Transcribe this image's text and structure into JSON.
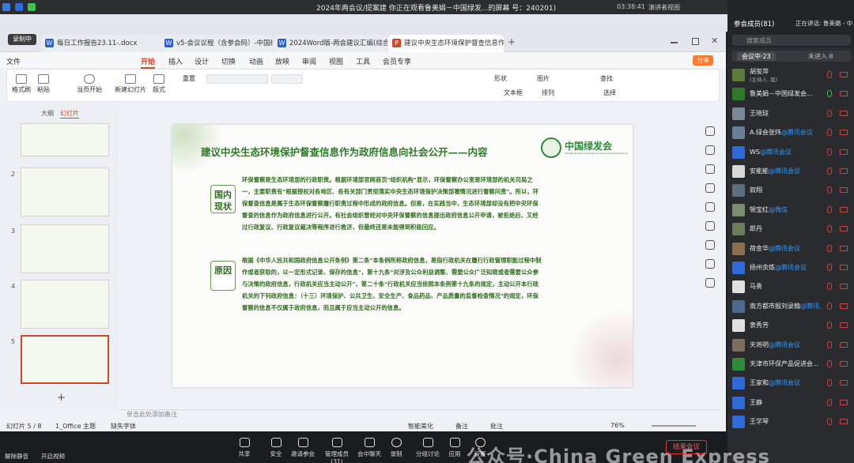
{
  "meeting": {
    "title": "2024年两会议/提案建",
    "screen_share_text": "你正在观看鲁美娟－中国绿发...的屏幕",
    "meeting_id": "号：240201)",
    "timer": "03:38:41",
    "view_label": "演讲者视图",
    "recording_label": "录制中"
  },
  "ppt": {
    "tabs": [
      {
        "label": "每日工作报告23.11-.docx",
        "color": "#2b5fd9",
        "icon": "W"
      },
      {
        "label": "v5-会议议程（含参会码）-中国绿发",
        "color": "#2b5fd9",
        "icon": "W"
      },
      {
        "label": "2024Word版-两会建议汇编(综合版)",
        "color": "#2b5fd9",
        "icon": "W"
      },
      {
        "label": "建议中央生态环境保护督查信息作",
        "color": "#d24726",
        "icon": "P"
      }
    ],
    "menu": [
      "文件",
      "开始",
      "插入",
      "设计",
      "切换",
      "动画",
      "放映",
      "审阅",
      "视图",
      "工具",
      "会员专享"
    ],
    "share_label": "分享",
    "ribbon": [
      "格式刷",
      "粘贴",
      "当页开始",
      "新建幻灯片",
      "版式",
      "重置",
      "形状",
      "图片",
      "查找",
      "文本框",
      "排列",
      "选择"
    ],
    "panel_tabs": [
      "大纲",
      "幻灯片"
    ],
    "notes_placeholder": "单击此处添加备注",
    "status": {
      "slide_pos": "幻灯片 5 / 8",
      "theme": "1_Office 主题",
      "font_missing": "缺失字体",
      "beautify": "智能美化",
      "notes": "备注",
      "comments": "批注",
      "zoom": "76%"
    }
  },
  "slide": {
    "title": "建议中央生态环境保护督查信息作为政府信息向社会公开——内容",
    "logo_text": "中国绿发会",
    "logo_sub": "China Biodiversity Conservation and Green Development Foundation",
    "sections": [
      {
        "label": "国内现状",
        "text": "环保督察是生态环境部的行政职责。根据环境部官网首页\"组织机构\"显示，环保督察办公室是环境部的机关司局之一，主要职责有\"根据授权对各地区、各有关部门贯彻落实中央生态环境保护决策部署情况进行督察问责\"。所以，环保督查信息是属于生态环保督察履行职责过程中形成的政府信息。但是，在实践当中，生态环境部却没有把中央环保督查的信息作为政府信息进行公开。有社会组织曾经对中央环保督察的信息提出政府信息公开申请，被拒绝后，又经过行政复议、行政复议裁决等程序进行救济，但最终还是未能得到积极回应。"
      },
      {
        "label": "原因",
        "text": "根据《中华人民共和国政府信息公开条例》第二条\"本条例所称政府信息，是指行政机关在履行行政管理职能过程中制作或者获取的，以一定形式记录、保存的信息\"，第十九条\"对涉及公众利益调整、需要公众广泛知晓或者需要公众参与决策的政府信息，行政机关应当主动公开\"，第二十条\"行政机关应当依照本条例第十九条的规定，主动公开本行政机关的下列政府信息：（十三）环境保护、公共卫生、安全生产、食品药品、产品质量的监督检查情况\"的规定，环保督察的信息不仅属于政府信息，而且属于应当主动公开的信息。"
      }
    ]
  },
  "participants": {
    "header": "参会成员(81)",
    "speaking": "正在讲话: 鲁美娟 - 中国绿",
    "search_placeholder": "搜索成员",
    "tabs": [
      "会议中·23",
      "未进入·8"
    ],
    "list": [
      {
        "name": "胡玺萍",
        "sub": "(主持人, 我)",
        "tag": "",
        "color": "#5a7d3a"
      },
      {
        "name": "鲁美娟－中国绿发会...",
        "sub": "",
        "tag": "",
        "color": "#2f7a2a"
      },
      {
        "name": "王晓琼",
        "sub": "",
        "tag": "",
        "color": "#7a8899"
      },
      {
        "name": "A.绿会张炜",
        "sub": "",
        "tag": "@腾讯会议",
        "color": "#6a7f95"
      },
      {
        "name": "WS",
        "sub": "",
        "tag": "@腾讯会议",
        "color": "#2e6bd8"
      },
      {
        "name": "安能能",
        "sub": "",
        "tag": "@腾讯会议",
        "color": "#d8d8d8"
      },
      {
        "name": "叙翔",
        "sub": "",
        "tag": "",
        "color": "#5c6f80"
      },
      {
        "name": "顿宝红",
        "sub": "",
        "tag": "@微信",
        "color": "#7b8d6a"
      },
      {
        "name": "郎丹",
        "sub": "",
        "tag": "",
        "color": "#6d7d5b"
      },
      {
        "name": "荷金华",
        "sub": "",
        "tag": "@腾讯会议",
        "color": "#8a6f4d"
      },
      {
        "name": "扬州余炼",
        "sub": "",
        "tag": "@腾讯会议",
        "color": "#2e6bd8"
      },
      {
        "name": "马勇",
        "sub": "",
        "tag": "",
        "color": "#e0e0e0"
      },
      {
        "name": "南方都市报刘录翰",
        "sub": "",
        "tag": "@腾讯...",
        "color": "#4d6a8c"
      },
      {
        "name": "衷秀芳",
        "sub": "",
        "tag": "",
        "color": "#e0e0e0"
      },
      {
        "name": "天将明",
        "sub": "",
        "tag": "@腾讯会议",
        "color": "#7d6f5a"
      },
      {
        "name": "天津市环保产品促进会...",
        "sub": "",
        "tag": "",
        "color": "#2f8a3a"
      },
      {
        "name": "王家和",
        "sub": "",
        "tag": "@腾讯会议",
        "color": "#2e6bd8"
      },
      {
        "name": "王静",
        "sub": "",
        "tag": "",
        "color": "#2e6bd8"
      },
      {
        "name": "王学琴",
        "sub": "",
        "tag": "",
        "color": "#2e6bd8"
      }
    ]
  },
  "toolbar": {
    "left_label": "解除静音",
    "left_label2": "开启视频",
    "items": [
      "共享",
      "安全",
      "邀请参会",
      "管理成员(31)",
      "会中聊天",
      "录制",
      "分组讨论",
      "应用",
      "设置"
    ],
    "end_label": "结束会议",
    "watermark": "公众号·China Green Express"
  }
}
